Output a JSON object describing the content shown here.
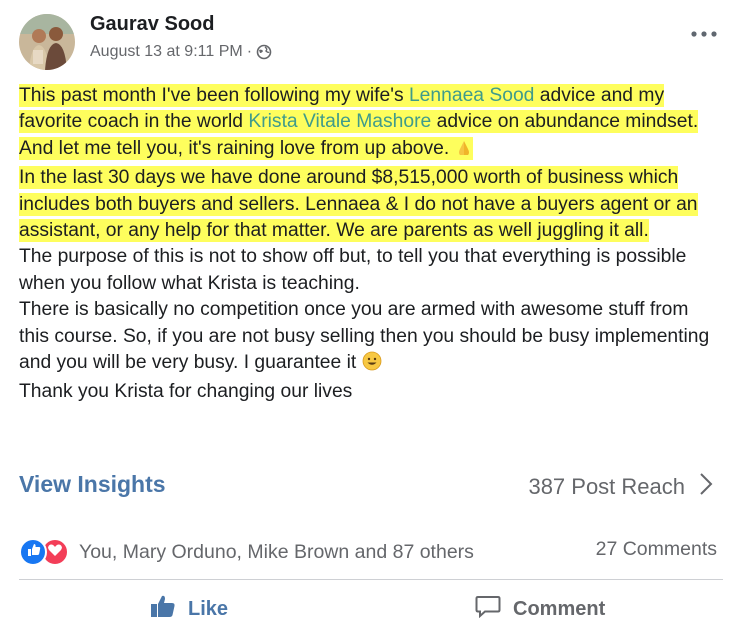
{
  "header": {
    "author_name": "Gaurav Sood",
    "timestamp": "August 13 at 9:11 PM",
    "separator": "·",
    "privacy_icon": "globe-icon",
    "more_icon": "more-options-icon"
  },
  "post": {
    "p1_part1": "This past month I've been following my wife's ",
    "p1_link1": "Lennaea Sood",
    "p1_part2": " advice and my favorite coach in the world ",
    "p1_link2": "Krista Vitale Mashore",
    "p1_part3": " advice on abundance mindset. And let me tell you, it's raining love from up above. ",
    "p2": "In the last 30 days we have done around $8,515,000 worth of business which includes both buyers and sellers. Lennaea & I do not have a buyers agent or an assistant, or any help for that matter. We are parents as well juggling it all.",
    "p3": "The purpose of this is not to show off but, to tell you that everything is possible when you follow what Krista is teaching.",
    "p4": "There is basically no competition once you are armed with awesome stuff from this course. So, if you are not busy selling then you should be busy implementing and you will be very busy. I guarantee it ",
    "p5": "Thank you Krista for changing our lives"
  },
  "insights": {
    "view_label": "View Insights",
    "reach_label": "387 Post Reach"
  },
  "engagement": {
    "reactors": "You, Mary Orduno, Mike Brown and 87 others",
    "comments": "27 Comments"
  },
  "actions": {
    "like_label": "Like",
    "comment_label": "Comment"
  },
  "colors": {
    "highlight": "#fefe5d",
    "link": "#3f9b8b",
    "accent_blue": "#4a76a8",
    "secondary_text": "#65676b"
  }
}
